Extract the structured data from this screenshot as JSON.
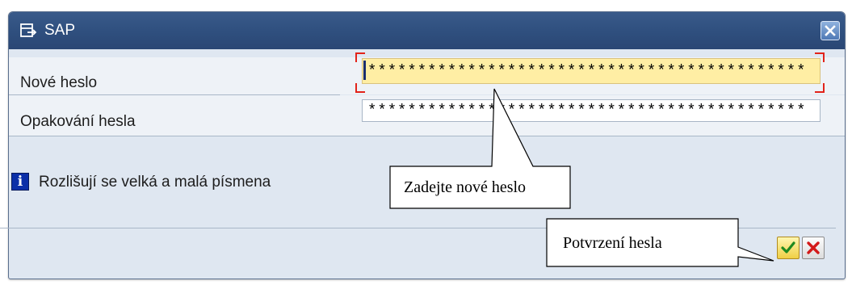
{
  "window": {
    "title": "SAP",
    "title_icon": "dialog-window-icon",
    "close_icon": "close-icon"
  },
  "form": {
    "new_password_label": "Nové heslo",
    "new_password_value": "********************************************",
    "repeat_password_label": "Opakování hesla",
    "repeat_password_value": "********************************************"
  },
  "info": {
    "icon": "info-icon",
    "icon_glyph": "i",
    "message": "Rozlišují se velká a malá písmena"
  },
  "buttons": {
    "confirm_icon": "checkmark-icon",
    "cancel_icon": "cross-icon"
  },
  "annotations": {
    "callout_new_password": "Zadejte nové heslo",
    "callout_confirm": "Potvrzení hesla"
  },
  "colors": {
    "titlebar": "#2f4f7e",
    "focused_field": "#ffeea4",
    "focus_corners": "#e2231a",
    "info_icon": "#0b2fa8"
  }
}
